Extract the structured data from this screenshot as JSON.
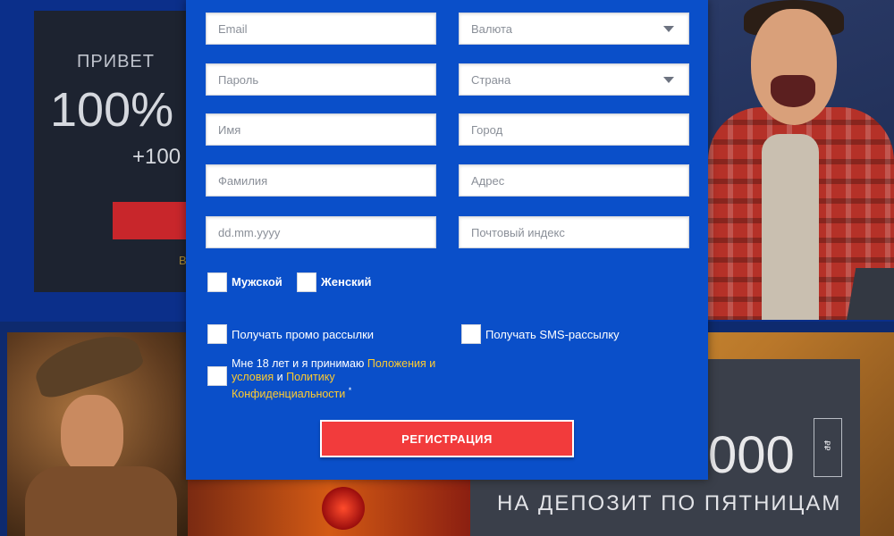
{
  "background": {
    "promo_left": {
      "greeting": "ПРИВЕТ",
      "bonus_percent": "100%",
      "bonus_extra": "+100",
      "footer_fragment": "B"
    },
    "promo_right": {
      "amount": "000",
      "caption": "НА ДЕПОЗИТ ПО ПЯТНИЦАМ",
      "box_text": "₽₽"
    }
  },
  "form": {
    "fields": {
      "email": {
        "placeholder": "Email"
      },
      "currency": {
        "placeholder": "Валюта"
      },
      "password": {
        "placeholder": "Пароль"
      },
      "country": {
        "placeholder": "Страна"
      },
      "first_name": {
        "placeholder": "Имя"
      },
      "city": {
        "placeholder": "Город"
      },
      "last_name": {
        "placeholder": "Фамилия"
      },
      "address": {
        "placeholder": "Адрес"
      },
      "birth_date": {
        "placeholder": "dd.mm.yyyy"
      },
      "postal_code": {
        "placeholder": "Почтовый индекс"
      }
    },
    "gender": {
      "male_label": "Мужской",
      "female_label": "Женский"
    },
    "subscriptions": {
      "promo_label": "Получать промо рассылки",
      "sms_label": "Получать SMS-рассылку"
    },
    "terms": {
      "prefix": "Мне 18 лет и я принимаю",
      "terms_link": "Положения и условия",
      "conjunction": "и",
      "privacy_link": "Политику Конфиденциальности",
      "required_mark": "*"
    },
    "submit_label": "РЕГИСТРАЦИЯ"
  },
  "colors": {
    "modal_bg": "#0a4fc9",
    "link": "#ffcb2e",
    "submit_bg": "#f23b3c"
  }
}
